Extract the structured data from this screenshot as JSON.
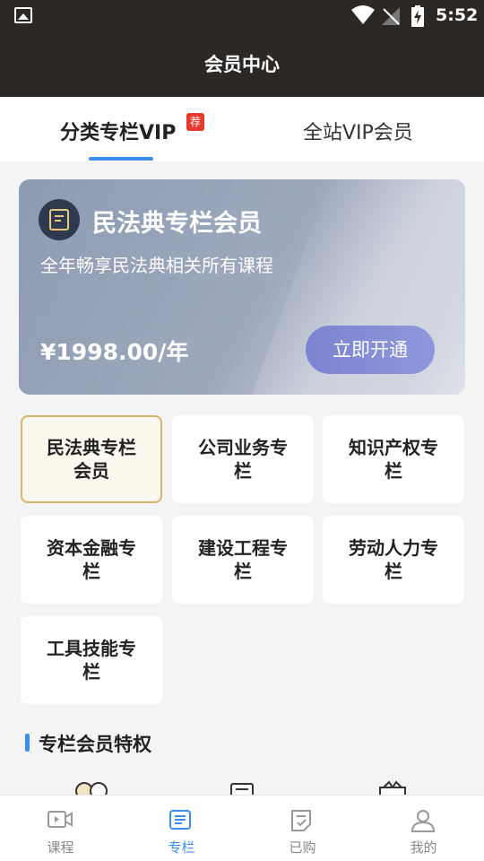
{
  "status_bar": {
    "time": "5:52"
  },
  "header": {
    "title": "会员中心"
  },
  "tabs": [
    {
      "label": "分类专栏VIP",
      "badge": "荐",
      "active": true
    },
    {
      "label": "全站VIP会员",
      "active": false
    }
  ],
  "card": {
    "title": "民法典专栏会员",
    "subtitle": "全年畅享民法典相关所有课程",
    "price": "¥1998.00/年",
    "button": "立即开通"
  },
  "categories": [
    {
      "label": "民法典专栏会员",
      "active": true
    },
    {
      "label": "公司业务专栏"
    },
    {
      "label": "知识产权专栏"
    },
    {
      "label": "资本金融专栏"
    },
    {
      "label": "建设工程专栏"
    },
    {
      "label": "劳动人力专栏"
    },
    {
      "label": "工具技能专栏"
    }
  ],
  "privileges": {
    "title": "专栏会员特权"
  },
  "bottom_nav": [
    {
      "label": "课程",
      "icon": "video-icon"
    },
    {
      "label": "专栏",
      "icon": "column-icon",
      "active": true
    },
    {
      "label": "已购",
      "icon": "purchased-icon"
    },
    {
      "label": "我的",
      "icon": "user-icon"
    }
  ],
  "colors": {
    "accent": "#3a8ef0",
    "header_bg": "#2b2826",
    "badge": "#e53a2e",
    "active_border": "#d7b273"
  }
}
